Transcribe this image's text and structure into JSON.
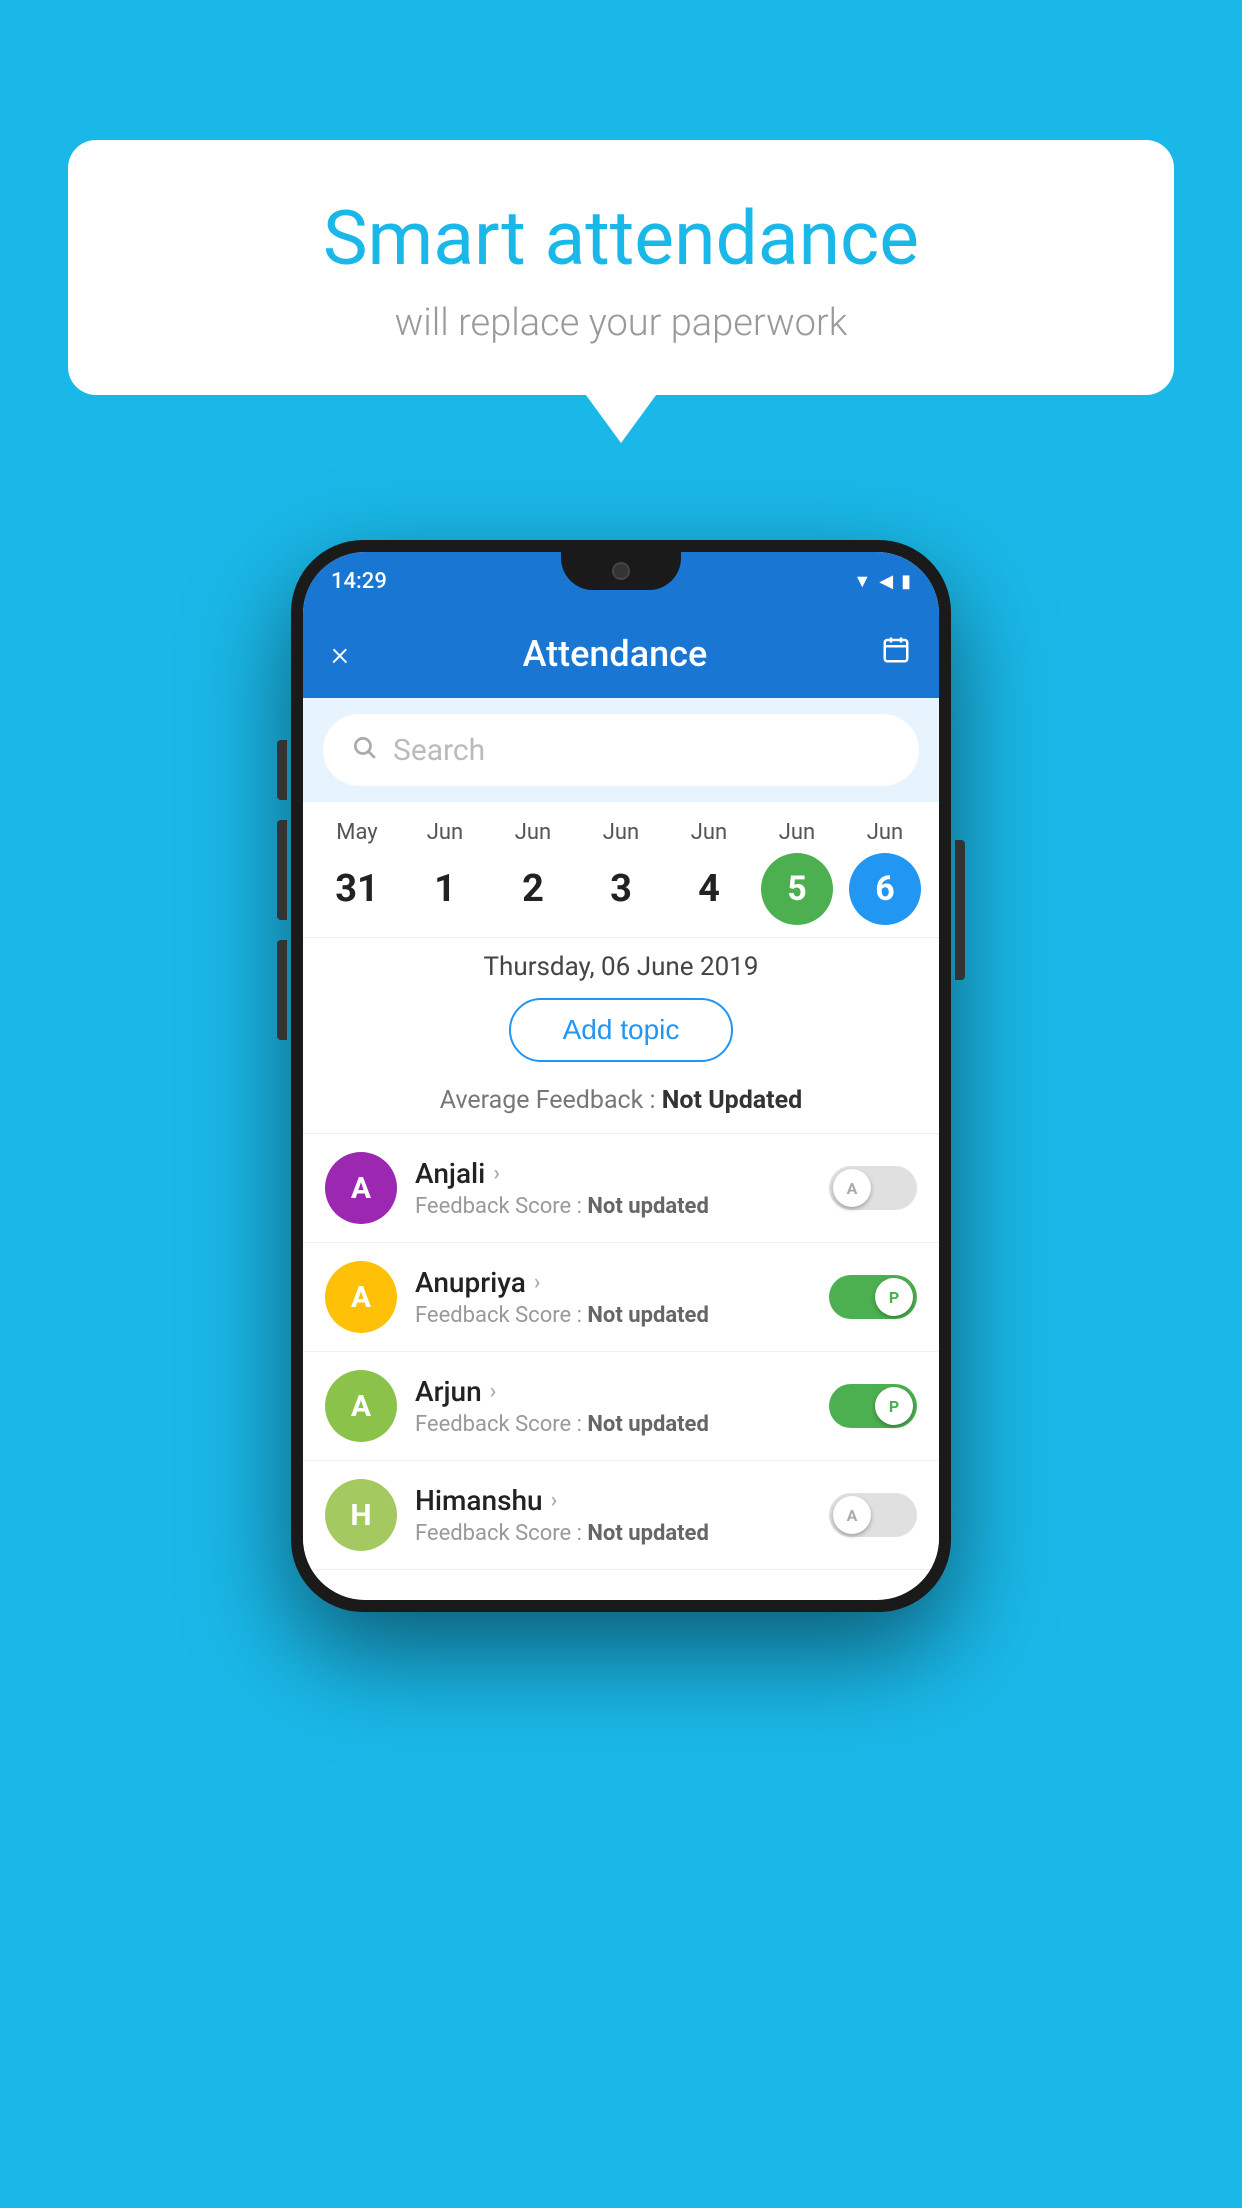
{
  "background_color": "#1ab8e8",
  "speech_bubble": {
    "title": "Smart attendance",
    "subtitle": "will replace your paperwork"
  },
  "app": {
    "status_time": "14:29",
    "toolbar_title": "Attendance",
    "close_button": "×",
    "search_placeholder": "Search",
    "selected_date_label": "Thursday, 06 June 2019",
    "add_topic_label": "Add topic",
    "avg_feedback_label": "Average Feedback :",
    "avg_feedback_value": "Not Updated"
  },
  "calendar": {
    "days": [
      {
        "month": "May",
        "date": "31",
        "selected": false
      },
      {
        "month": "Jun",
        "date": "1",
        "selected": false
      },
      {
        "month": "Jun",
        "date": "2",
        "selected": false
      },
      {
        "month": "Jun",
        "date": "3",
        "selected": false
      },
      {
        "month": "Jun",
        "date": "4",
        "selected": false
      },
      {
        "month": "Jun",
        "date": "5",
        "selected": "green"
      },
      {
        "month": "Jun",
        "date": "6",
        "selected": "blue"
      }
    ]
  },
  "students": [
    {
      "name": "Anjali",
      "avatar_letter": "A",
      "avatar_color": "purple",
      "feedback": "Not updated",
      "toggle_state": "off",
      "toggle_label": "A"
    },
    {
      "name": "Anupriya",
      "avatar_letter": "A",
      "avatar_color": "yellow",
      "feedback": "Not updated",
      "toggle_state": "on",
      "toggle_label": "P"
    },
    {
      "name": "Arjun",
      "avatar_letter": "A",
      "avatar_color": "green-light",
      "feedback": "Not updated",
      "toggle_state": "on",
      "toggle_label": "P"
    },
    {
      "name": "Himanshu",
      "avatar_letter": "H",
      "avatar_color": "olive",
      "feedback": "Not updated",
      "toggle_state": "off",
      "toggle_label": "A"
    }
  ],
  "labels": {
    "feedback_score": "Feedback Score :"
  }
}
